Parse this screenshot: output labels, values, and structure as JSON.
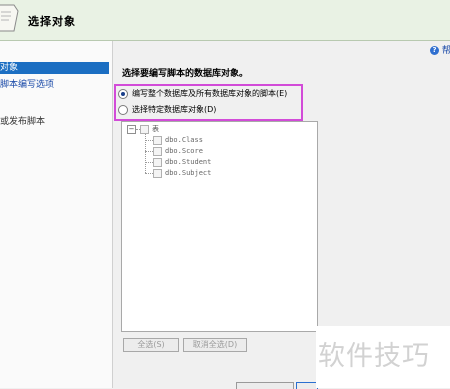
{
  "header": {
    "title": "选择对象"
  },
  "nav": {
    "items": [
      {
        "label": "对象",
        "selected": true
      },
      {
        "label": "脚本编写选项",
        "selected": false
      },
      {
        "label": "或发布脚本",
        "selected": false
      }
    ]
  },
  "help": {
    "label": "帮"
  },
  "main": {
    "section_title": "选择要编写脚本的数据库对象。",
    "options": [
      {
        "label": "编写整个数据库及所有数据库对象的脚本(E)",
        "checked": true
      },
      {
        "label": "选择特定数据库对象(D)",
        "checked": false
      }
    ],
    "tree": {
      "root_label": "表",
      "children": [
        "dbo.Class",
        "dbo.Score",
        "dbo.Student",
        "dbo.Subject"
      ]
    },
    "buttons": {
      "select_all": "全选(S)",
      "deselect_all": "取消全选(D)"
    }
  },
  "watermark": "软件技巧",
  "colors": {
    "header_bg": "#e9f2e4",
    "selected_nav": "#1b6ec2",
    "highlight_border": "#d24bd8"
  }
}
